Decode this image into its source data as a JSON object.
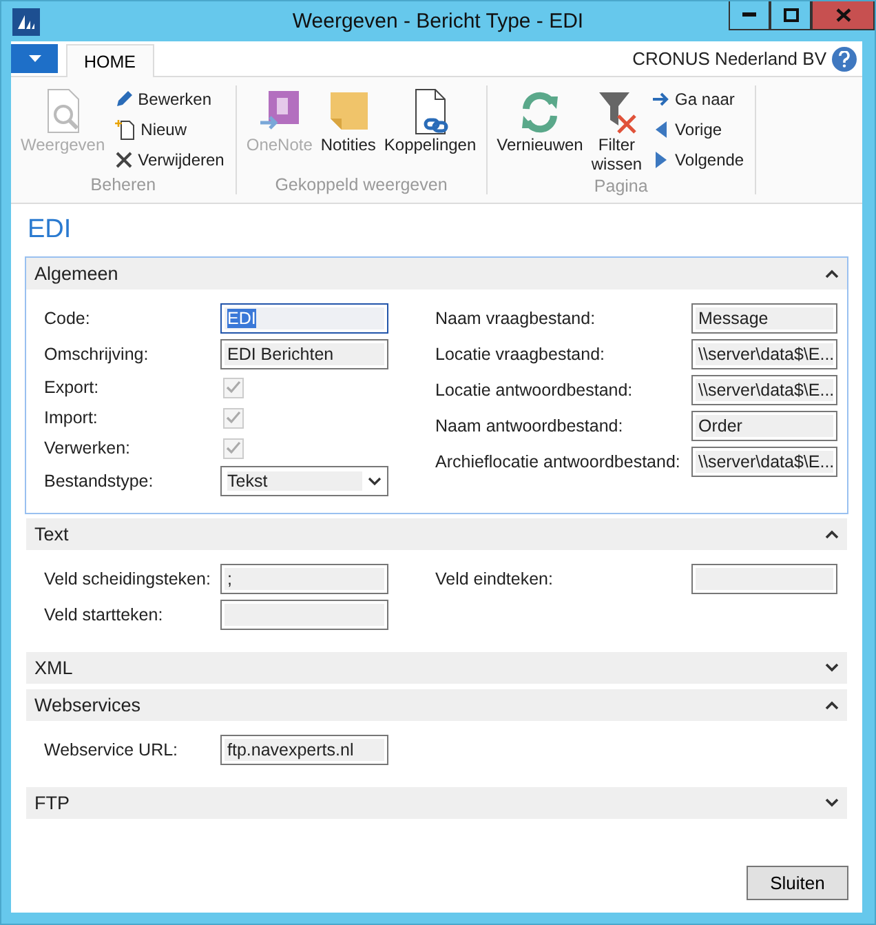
{
  "window": {
    "title": "Weergeven - Bericht Type - EDI"
  },
  "ribbon": {
    "tabs": [
      {
        "label": "HOME",
        "selected": true
      }
    ],
    "company": "CRONUS Nederland BV",
    "groups": [
      {
        "label": "Beheren",
        "items": [
          {
            "kind": "large",
            "label": "Weergeven",
            "disabled": true
          },
          {
            "kind": "small",
            "label": "Bewerken",
            "disabled": false
          },
          {
            "kind": "small",
            "label": "Nieuw",
            "disabled": false
          },
          {
            "kind": "small",
            "label": "Verwijderen",
            "disabled": false
          }
        ]
      },
      {
        "label": "Gekoppeld weergeven",
        "items": [
          {
            "kind": "large",
            "label": "OneNote",
            "disabled": true
          },
          {
            "kind": "large",
            "label": "Notities",
            "disabled": false
          },
          {
            "kind": "large",
            "label": "Koppelingen",
            "disabled": false
          }
        ]
      },
      {
        "label": "Pagina",
        "items": [
          {
            "kind": "large",
            "label": "Vernieuwen",
            "disabled": false
          },
          {
            "kind": "large",
            "label": "Filter wissen",
            "disabled": false
          },
          {
            "kind": "small",
            "label": "Ga naar",
            "disabled": false
          },
          {
            "kind": "small",
            "label": "Vorige",
            "disabled": false
          },
          {
            "kind": "small",
            "label": "Volgende",
            "disabled": false
          }
        ]
      }
    ]
  },
  "page_title": "EDI",
  "sections": [
    {
      "title": "Algemeen",
      "expanded": true,
      "focused": true,
      "left": [
        {
          "kind": "text",
          "label": "Code:",
          "value": "EDI",
          "focused": true
        },
        {
          "kind": "text",
          "label": "Omschrijving:",
          "value": "EDI Berichten",
          "focused": false
        },
        {
          "kind": "checkbox",
          "label": "Export:",
          "checked": true
        },
        {
          "kind": "checkbox",
          "label": "Import:",
          "checked": true
        },
        {
          "kind": "checkbox",
          "label": "Verwerken:",
          "checked": true
        },
        {
          "kind": "select",
          "label": "Bestandstype:",
          "value": "Tekst"
        }
      ],
      "right": [
        {
          "kind": "text",
          "label": "Naam vraagbestand:",
          "value": "Message",
          "focused": false
        },
        {
          "kind": "text",
          "label": "Locatie vraagbestand:",
          "value": "\\\\server\\data$\\E...",
          "focused": false
        },
        {
          "kind": "text",
          "label": "Locatie antwoordbestand:",
          "value": "\\\\server\\data$\\E...",
          "focused": false
        },
        {
          "kind": "text",
          "label": "Naam antwoordbestand:",
          "value": "Order",
          "focused": false
        },
        {
          "kind": "text",
          "label": "Archieflocatie antwoordbestand:",
          "value": "\\\\server\\data$\\E...",
          "focused": false
        }
      ]
    },
    {
      "title": "Text",
      "expanded": true,
      "focused": false,
      "left": [
        {
          "kind": "text",
          "label": "Veld scheidingsteken:",
          "value": ";",
          "focused": false
        },
        {
          "kind": "text",
          "label": "Veld startteken:",
          "focused": false
        }
      ],
      "right": [
        {
          "kind": "text",
          "label": "Veld eindteken:",
          "focused": false
        }
      ]
    },
    {
      "title": "XML",
      "expanded": false,
      "focused": false
    },
    {
      "title": "Webservices",
      "expanded": true,
      "focused": false,
      "left": [
        {
          "kind": "text",
          "label": "Webservice URL:",
          "value": "ftp.navexperts.nl",
          "focused": false
        }
      ]
    },
    {
      "title": "FTP",
      "expanded": false,
      "focused": false
    }
  ],
  "buttons": [
    "Sluiten"
  ]
}
